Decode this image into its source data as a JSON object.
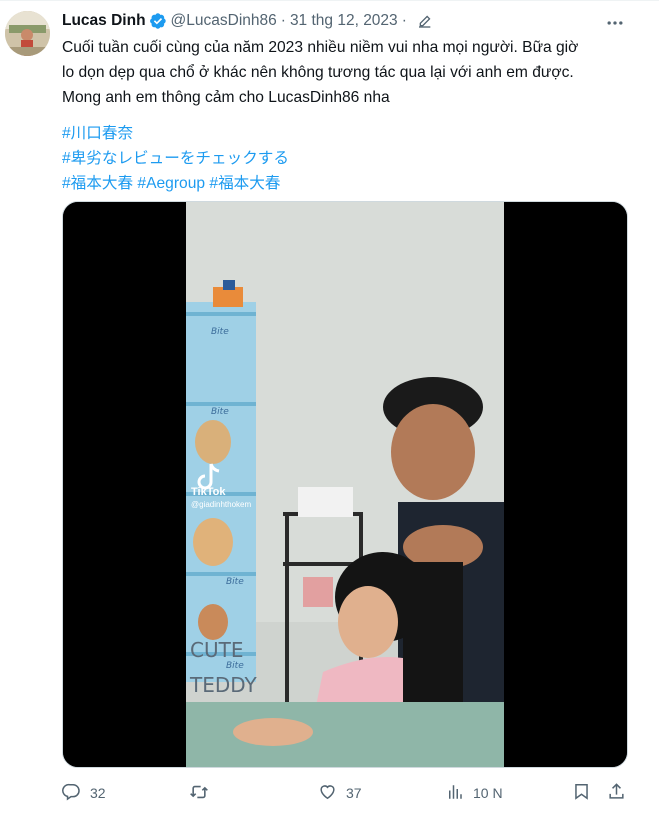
{
  "author": {
    "name": "Lucas Dinh",
    "handle": "@LucasDinh86",
    "date": "31 thg 12, 2023"
  },
  "tweet": {
    "lines": [
      "Cuối tuần cuối cùng của năm 2023 nhiều niềm vui nha mọi người. Bữa giờ",
      "lo dọn dẹp qua chổ ở khác nên không tương tác qua lại với anh em được.",
      "Mong anh em thông cảm cho LucasDinh86 nha"
    ],
    "hashtags": {
      "line1": "#川口春奈",
      "line2": "#卑劣なレビューをチェックする",
      "line3": [
        "#福本大春",
        "#Aegroup",
        "#福本大春"
      ]
    }
  },
  "media": {
    "watermark_brand": "TikTok",
    "watermark_user": "@giadinhthokem",
    "shelf_label": "Bite",
    "shelf_text_1": "CUTE",
    "shelf_text_2": "TEDDY"
  },
  "actions": {
    "replies": "32",
    "retweets": "",
    "likes": "37",
    "views": "10 N"
  },
  "colors": {
    "accent": "#1d9bf0",
    "text": "#0f1419",
    "muted": "#536471"
  },
  "icons": [
    "verified-badge-icon",
    "edit-icon",
    "more-icon",
    "reply-icon",
    "retweet-icon",
    "like-icon",
    "views-icon",
    "bookmark-icon",
    "share-icon"
  ]
}
